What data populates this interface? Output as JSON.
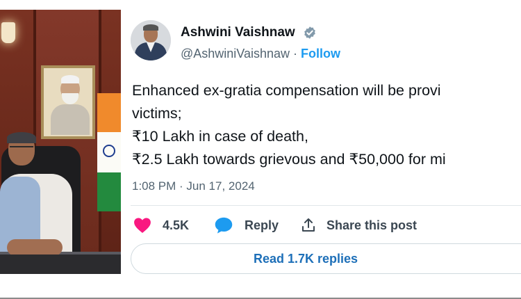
{
  "tweet": {
    "author_name": "Ashwini Vaishnaw",
    "handle": "@AshwiniVaishnaw",
    "separator": " · ",
    "follow_label": "Follow",
    "text_lines": [
      "Enhanced ex-gratia compensation will be provi",
      "victims;",
      "₹10 Lakh in case of death,",
      "₹2.5 Lakh towards grievous and ₹50,000 for mi"
    ],
    "timestamp": "1:08 PM · Jun 17, 2024",
    "likes": "4.5K",
    "reply_label": "Reply",
    "share_label": "Share this post",
    "read_replies_label": "Read 1.7K replies"
  },
  "colors": {
    "link_blue": "#1d9bf0",
    "like_pink": "#f91880",
    "reply_blue": "#1d9bf0",
    "text_dark": "#0f1419",
    "text_gray": "#536471"
  },
  "icons": {
    "verified": "verified-badge-icon",
    "like": "heart-icon",
    "reply": "speech-bubble-icon",
    "share": "share-upload-icon"
  }
}
